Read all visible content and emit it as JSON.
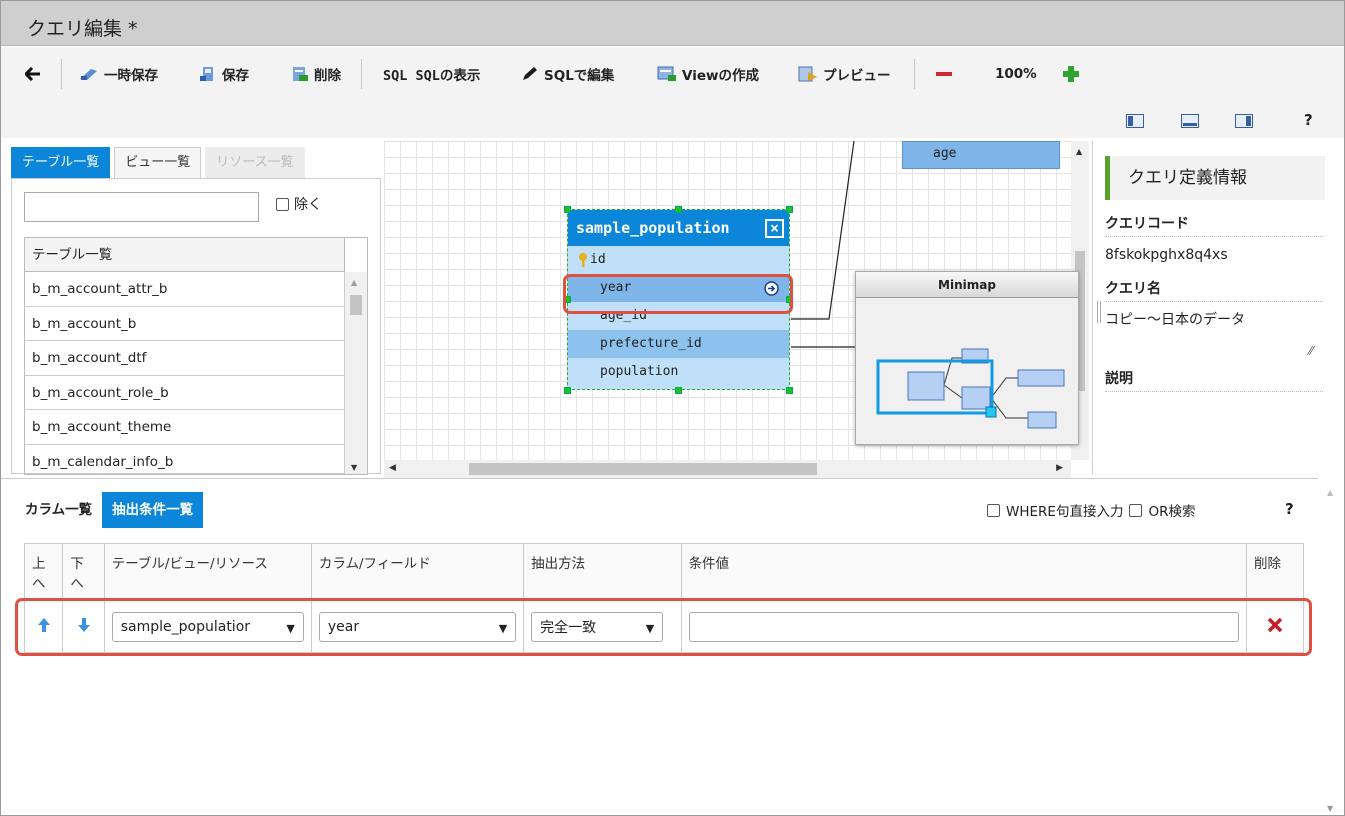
{
  "title": "クエリ編集 *",
  "toolbar": {
    "back_label": "",
    "temp_save": "一時保存",
    "save": "保存",
    "delete": "削除",
    "show_sql": "SQL SQLの表示",
    "edit_sql": "SQLで編集",
    "create_view": "Viewの作成",
    "preview": "プレビュー",
    "zoom": "100%",
    "help": "?"
  },
  "left_panel": {
    "tabs": [
      "テーブル一覧",
      "ビュー一覧",
      "リソース一覧"
    ],
    "search": {
      "value": "",
      "placeholder": ""
    },
    "exclude_label": "除く",
    "list_header": "テーブル一覧",
    "tables": [
      "b_m_account_attr_b",
      "b_m_account_b",
      "b_m_account_dtf",
      "b_m_account_role_b",
      "b_m_account_theme",
      "b_m_calendar_info_b"
    ]
  },
  "canvas": {
    "entity": {
      "name": "sample_population",
      "fields": [
        "id",
        "year",
        "age_id",
        "prefecture_id",
        "population"
      ]
    },
    "other_entity_field": "age",
    "minimap_title": "Minimap"
  },
  "right_panel": {
    "title": "クエリ定義情報",
    "code_label": "クエリコード",
    "code_value": "8fskokpghx8q4xs",
    "name_label": "クエリ名",
    "name_value": "コピー～日本のデータ",
    "desc_label": "説明"
  },
  "bottom_panel": {
    "tabs": [
      "カラム一覧",
      "抽出条件一覧"
    ],
    "where_label": "WHERE句直接入力",
    "or_label": "OR検索",
    "help": "?",
    "columns": {
      "up": "上へ",
      "down": "下へ",
      "table": "テーブル/ビュー/リソース",
      "column": "カラム/フィールド",
      "method": "抽出方法",
      "value": "条件値",
      "delete": "削除"
    },
    "row": {
      "table": "sample_populatior",
      "column": "year",
      "method": "完全一致",
      "value": ""
    }
  },
  "colors": {
    "accent": "#0b86d8",
    "highlight": "#e05040",
    "entity_bg": "#bfe0f8"
  }
}
